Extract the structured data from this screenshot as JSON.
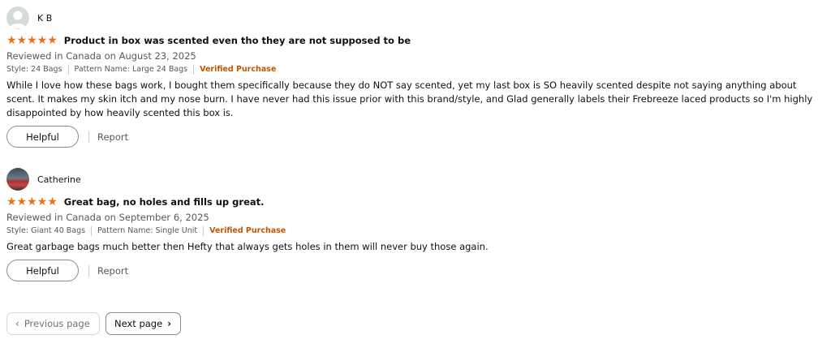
{
  "reviews": [
    {
      "name": "K B",
      "stars": "★★★★★",
      "title": "Product in box was scented even tho they are not supposed to be",
      "date": "Reviewed in Canada on August 23, 2025",
      "style": "Style: 24 Bags",
      "pattern": "Pattern Name: Large 24 Bags",
      "verified": "Verified Purchase",
      "body": "While I love how these bags work, I bought them specifically because they do NOT say scented, yet my last box is SO heavily scented despite not saying anything about scent. It makes my skin itch and my nose burn. I have never had this issue prior with this brand/style, and Glad generally labels their Frebreeze laced products so I'm highly disappointed by how heavily scented this box is.",
      "helpful": "Helpful",
      "report": "Report",
      "rating": 5
    },
    {
      "name": "Catherine",
      "stars": "★★★★★",
      "title": "Great bag, no holes and fills up great.",
      "date": "Reviewed in Canada on September 6, 2025",
      "style": "Style: Giant 40 Bags",
      "pattern": "Pattern Name: Single Unit",
      "verified": "Verified Purchase",
      "body": "Great garbage bags much better then Hefty that always gets holes in them will never buy those again.",
      "helpful": "Helpful",
      "report": "Report",
      "rating": 5
    }
  ],
  "pagination": {
    "prev_label": "Previous page",
    "next_label": "Next page",
    "prev_icon": "chevron-left-icon",
    "next_icon": "chevron-right-icon"
  },
  "colors": {
    "star": "#e8721c",
    "verified": "#c45500",
    "muted_text": "#565959"
  }
}
